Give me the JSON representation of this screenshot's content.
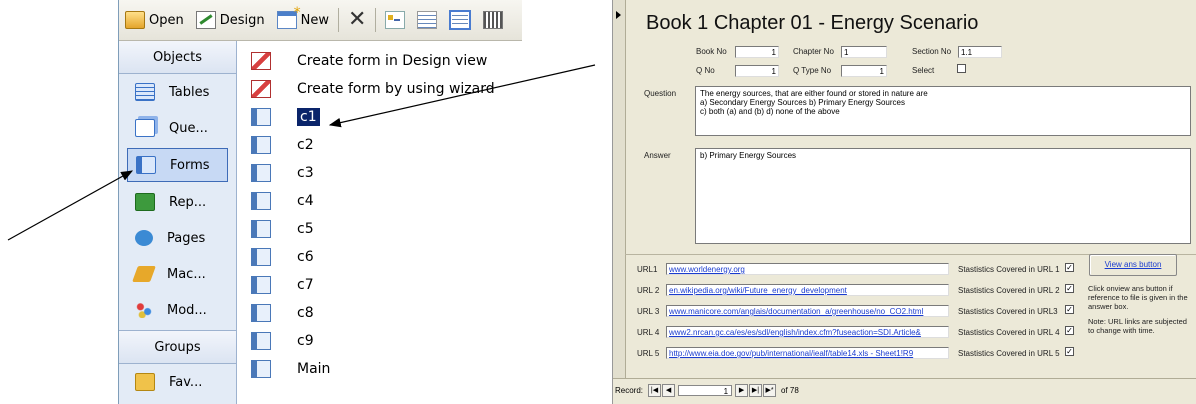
{
  "toolbar": {
    "open": "Open",
    "design": "Design",
    "new": "New"
  },
  "sidebar": {
    "objects_header": "Objects",
    "items": [
      {
        "label": "Tables",
        "icon": "table-icon"
      },
      {
        "label": "Que...",
        "icon": "query-icon"
      },
      {
        "label": "Forms",
        "icon": "form-icon",
        "active": true
      },
      {
        "label": "Rep...",
        "icon": "report-icon"
      },
      {
        "label": "Pages",
        "icon": "page-icon"
      },
      {
        "label": "Mac...",
        "icon": "macro-icon"
      },
      {
        "label": "Mod...",
        "icon": "module-icon"
      }
    ],
    "groups_header": "Groups",
    "groups_items": [
      {
        "label": "Fav...",
        "icon": "favorites-icon"
      }
    ]
  },
  "object_list": {
    "items": [
      "Create form in Design view",
      "Create form by using wizard",
      "c1",
      "c2",
      "c3",
      "c4",
      "c5",
      "c6",
      "c7",
      "c8",
      "c9",
      "Main"
    ],
    "selected": "c1"
  },
  "form": {
    "title": "Book 1 Chapter 01 - Energy Scenario",
    "book_no_label": "Book No",
    "book_no": "1",
    "chapter_no_label": "Chapter No",
    "chapter_no": "1",
    "section_no_label": "Section No",
    "section_no": "1.1",
    "q_no_label": "Q No",
    "q_no": "1",
    "q_type_no_label": "Q Type No",
    "q_type_no": "1",
    "select_label": "Select",
    "question_label": "Question",
    "question": "The energy sources, that are either found or stored in nature are\na) Secondary Energy Sources  b) Primary Energy Sources\nc) both (a) and (b)   d) none of the above",
    "answer_label": "Answer",
    "answer": "b) Primary Energy Sources",
    "urls": [
      {
        "label": "URL1",
        "value": "www.worldenergy.org",
        "stat_label": "Stastistics Covered in URL 1"
      },
      {
        "label": "URL 2",
        "value": "en.wikipedia.org/wiki/Future_energy_development",
        "stat_label": "Stastistics Covered in URL 2"
      },
      {
        "label": "URL 3",
        "value": "www.manicore.com/anglais/documentation_a/greenhouse/no_CO2.html",
        "stat_label": "Stastistics Covered in URL3"
      },
      {
        "label": "URL 4",
        "value": "www2.nrcan.gc.ca/es/es/sdl/english/index.cfm?fuseaction=SDI.Article&",
        "stat_label": "Stastistics Covered in URL 4"
      },
      {
        "label": "URL 5",
        "value": "http://www.eia.doe.gov/pub/international/iealf/table14.xls - Sheet1!R9",
        "stat_label": "Stastistics Covered in URL 5"
      }
    ],
    "view_ans_button": "View ans button",
    "note1": "Click onview ans  button if reference to file is given in the answer box.",
    "note2": "Note: URL links are subjected to change with time.",
    "record_label": "Record:",
    "record_current": "1",
    "record_total": "of  78"
  }
}
